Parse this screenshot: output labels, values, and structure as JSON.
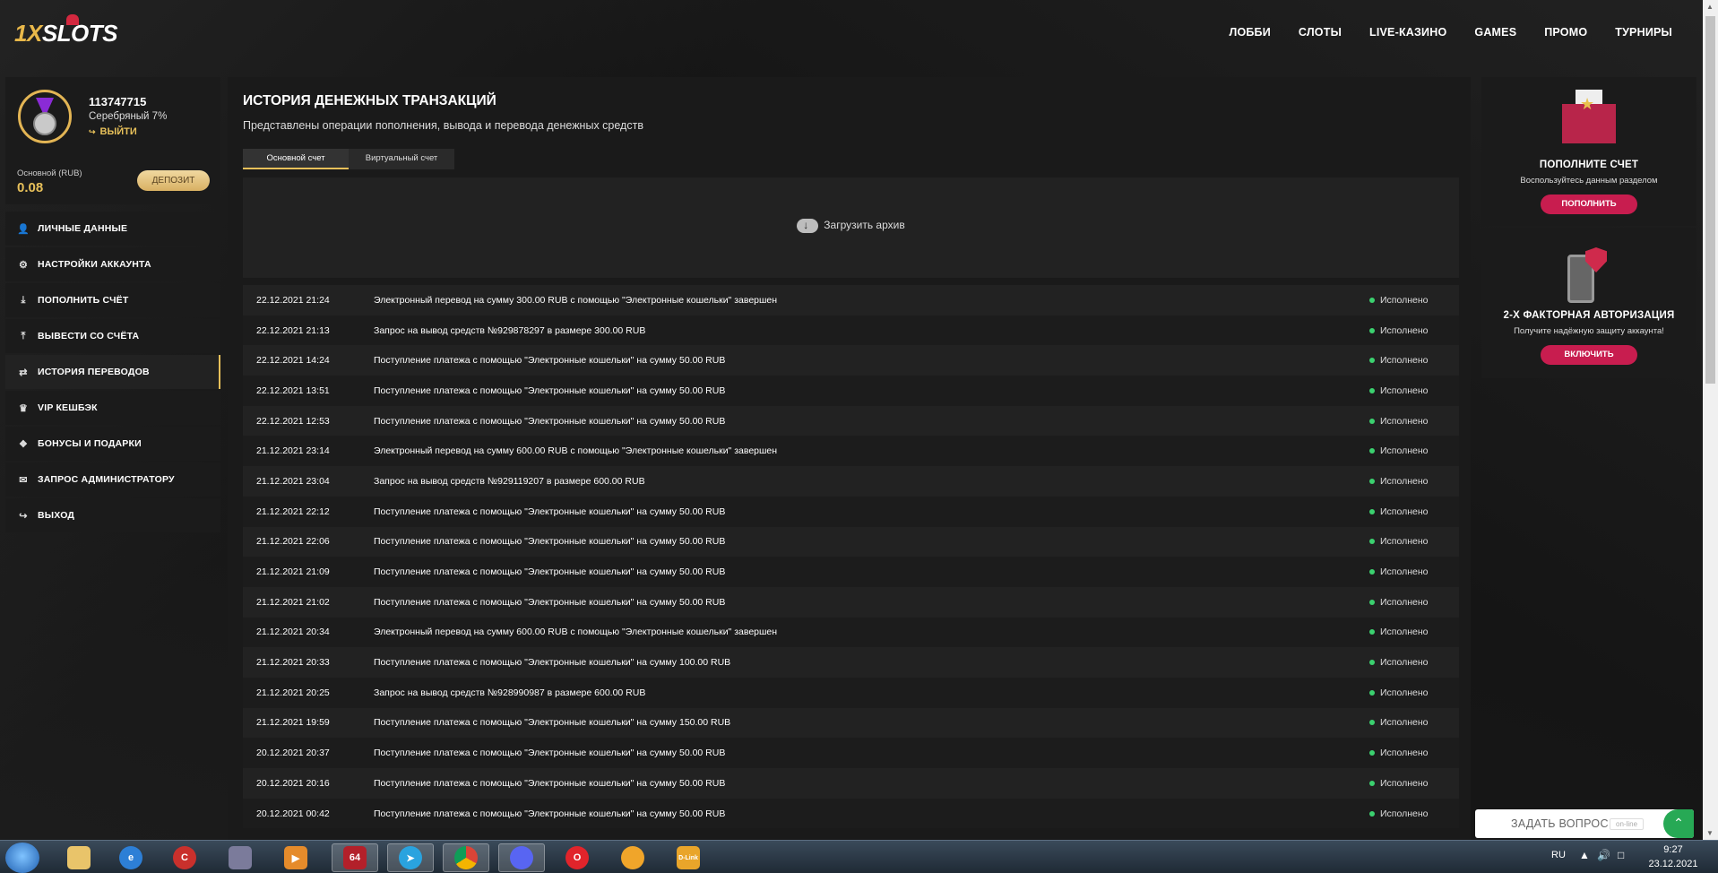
{
  "brand": {
    "logo_num": "1X",
    "logo_word": "SLOTS"
  },
  "nav": [
    "ЛОББИ",
    "СЛОТЫ",
    "LIVE-КАЗИНО",
    "GAMES",
    "ПРОМО",
    "ТУРНИРЫ"
  ],
  "profile": {
    "user_id": "113747715",
    "tier": "Серебряный 7%",
    "logout": "ВЫЙТИ",
    "balance_label": "Основной (RUB)",
    "balance": "0.08",
    "deposit_button": "ДЕПОЗИТ"
  },
  "menu": [
    {
      "label": "ЛИЧНЫЕ ДАННЫЕ",
      "icon": "user-add-icon"
    },
    {
      "label": "НАСТРОЙКИ АККАУНТА",
      "icon": "gears-icon"
    },
    {
      "label": "ПОПОЛНИТЬ СЧЁТ",
      "icon": "download-icon"
    },
    {
      "label": "ВЫВЕСТИ СО СЧЁТА",
      "icon": "upload-icon"
    },
    {
      "label": "ИСТОРИЯ ПЕРЕВОДОВ",
      "icon": "transfer-arrows-icon",
      "active": true
    },
    {
      "label": "VIP КЕШБЭК",
      "icon": "crown-icon"
    },
    {
      "label": "БОНУСЫ И ПОДАРКИ",
      "icon": "gift-icon"
    },
    {
      "label": "ЗАПРОС АДМИНИСТРАТОРУ",
      "icon": "envelope-icon"
    },
    {
      "label": "ВЫХОД",
      "icon": "exit-icon"
    }
  ],
  "main": {
    "title": "ИСТОРИЯ ДЕНЕЖНЫХ ТРАНЗАКЦИЙ",
    "subtitle": "Представлены операции пополнения, вывода и перевода денежных средств",
    "tabs": [
      {
        "label": "Основной счет",
        "active": true
      },
      {
        "label": "Виртуальный счет",
        "active": false
      }
    ],
    "archive_label": "Загрузить архив",
    "status_color": "#3bd16f",
    "transactions": [
      {
        "date": "22.12.2021 21:24",
        "desc": "Электронный перевод на сумму 300.00 RUB с помощью \"Электронные кошельки\" завершен",
        "status": "Исполнено"
      },
      {
        "date": "22.12.2021 21:13",
        "desc": "Запрос на вывод средств №929878297 в размере 300.00 RUB",
        "status": "Исполнено"
      },
      {
        "date": "22.12.2021 14:24",
        "desc": "Поступление платежа с помощью \"Электронные кошельки\" на сумму 50.00 RUB",
        "status": "Исполнено"
      },
      {
        "date": "22.12.2021 13:51",
        "desc": "Поступление платежа с помощью \"Электронные кошельки\" на сумму 50.00 RUB",
        "status": "Исполнено"
      },
      {
        "date": "22.12.2021 12:53",
        "desc": "Поступление платежа с помощью \"Электронные кошельки\" на сумму 50.00 RUB",
        "status": "Исполнено"
      },
      {
        "date": "21.12.2021 23:14",
        "desc": "Электронный перевод на сумму 600.00 RUB с помощью \"Электронные кошельки\" завершен",
        "status": "Исполнено"
      },
      {
        "date": "21.12.2021 23:04",
        "desc": "Запрос на вывод средств №929119207 в размере 600.00 RUB",
        "status": "Исполнено"
      },
      {
        "date": "21.12.2021 22:12",
        "desc": "Поступление платежа с помощью \"Электронные кошельки\" на сумму 50.00 RUB",
        "status": "Исполнено"
      },
      {
        "date": "21.12.2021 22:06",
        "desc": "Поступление платежа с помощью \"Электронные кошельки\" на сумму 50.00 RUB",
        "status": "Исполнено"
      },
      {
        "date": "21.12.2021 21:09",
        "desc": "Поступление платежа с помощью \"Электронные кошельки\" на сумму 50.00 RUB",
        "status": "Исполнено"
      },
      {
        "date": "21.12.2021 21:02",
        "desc": "Поступление платежа с помощью \"Электронные кошельки\" на сумму 50.00 RUB",
        "status": "Исполнено"
      },
      {
        "date": "21.12.2021 20:34",
        "desc": "Электронный перевод на сумму 600.00 RUB с помощью \"Электронные кошельки\" завершен",
        "status": "Исполнено"
      },
      {
        "date": "21.12.2021 20:33",
        "desc": "Поступление платежа с помощью \"Электронные кошельки\" на сумму 100.00 RUB",
        "status": "Исполнено"
      },
      {
        "date": "21.12.2021 20:25",
        "desc": "Запрос на вывод средств №928990987 в размере 600.00 RUB",
        "status": "Исполнено"
      },
      {
        "date": "21.12.2021 19:59",
        "desc": "Поступление платежа с помощью \"Электронные кошельки\" на сумму 150.00 RUB",
        "status": "Исполнено"
      },
      {
        "date": "20.12.2021 20:37",
        "desc": "Поступление платежа с помощью \"Электронные кошельки\" на сумму 50.00 RUB",
        "status": "Исполнено"
      },
      {
        "date": "20.12.2021 20:16",
        "desc": "Поступление платежа с помощью \"Электронные кошельки\" на сумму 50.00 RUB",
        "status": "Исполнено"
      },
      {
        "date": "20.12.2021 00:42",
        "desc": "Поступление платежа с помощью \"Электронные кошельки\" на сумму 50.00 RUB",
        "status": "Исполнено"
      }
    ]
  },
  "side_cards": [
    {
      "title": "ПОПОЛНИТЕ СЧЕТ",
      "desc": "Воспользуйтесь данным разделом",
      "button": "ПОПОЛНИТЬ",
      "icon": "envelope-star-icon"
    },
    {
      "title": "2-Х ФАКТОРНАЯ АВТОРИЗАЦИЯ",
      "desc": "Получите надёжную защиту аккаунта!",
      "button": "ВКЛЮЧИТЬ",
      "icon": "phone-shield-icon"
    }
  ],
  "chat": {
    "label": "ЗАДАТЬ ВОПРОС",
    "badge": "on-line"
  },
  "taskbar": {
    "apps": [
      "explorer-icon",
      "ie-icon",
      "ccleaner-icon",
      "archiver-icon",
      "media-player-icon",
      "aida64-icon",
      "telegram-icon",
      "chrome-icon",
      "discord-icon",
      "opera-icon",
      "vpn-icon",
      "dlink-icon"
    ],
    "aida_label": "64",
    "dlink_label": "D-Link",
    "lang": "RU",
    "time": "9:27",
    "date": "23.12.2021"
  },
  "colors": {
    "accent": "#e7c05a",
    "pink": "#c81d4f",
    "online": "#27a955"
  }
}
